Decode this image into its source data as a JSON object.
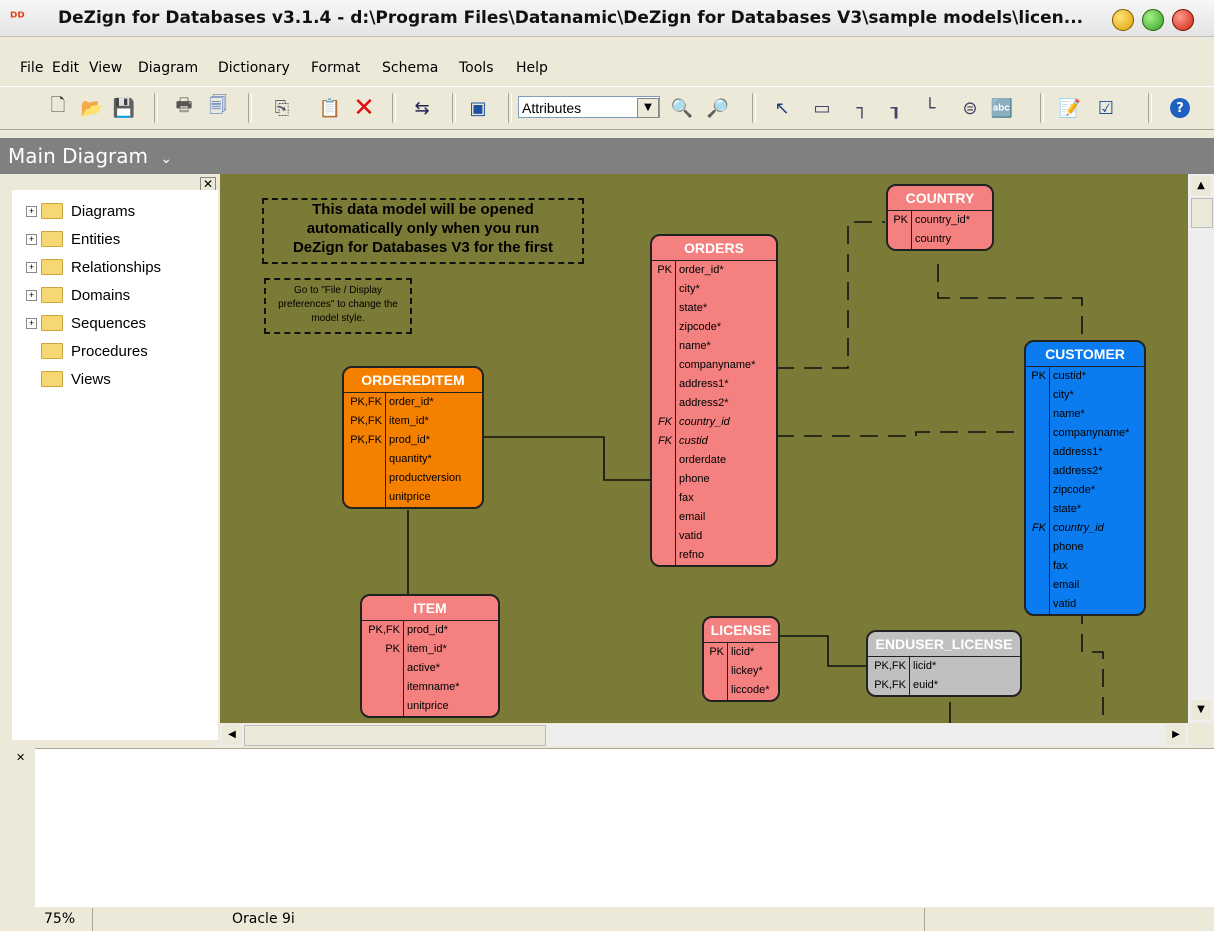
{
  "window": {
    "title": "DeZign for Databases v3.1.4 - d:\\Program Files\\Datanamic\\DeZign for Databases V3\\sample models\\licen..."
  },
  "menu": [
    "File",
    "Edit",
    "View",
    "Diagram",
    "Dictionary",
    "Format",
    "Schema",
    "Tools",
    "Help"
  ],
  "toolbar": {
    "display_mode": "Attributes"
  },
  "diagram_tab": {
    "label": "Main Diagram"
  },
  "tree": [
    "Diagrams",
    "Entities",
    "Relationships",
    "Domains",
    "Sequences",
    "Procedures",
    "Views"
  ],
  "notes": {
    "main": [
      "This data model will be opened",
      "automatically only when you run",
      "DeZign for Databases V3 for the first"
    ],
    "style": [
      "Go to \"File / Display",
      "preferences\" to change the",
      "model style."
    ]
  },
  "entities": {
    "country": {
      "name": "COUNTRY",
      "rows": [
        [
          "PK",
          "country_id*"
        ],
        [
          "",
          "country"
        ]
      ]
    },
    "orders": {
      "name": "ORDERS",
      "rows": [
        [
          "PK",
          "order_id*"
        ],
        [
          "",
          "city*"
        ],
        [
          "",
          "state*"
        ],
        [
          "",
          "zipcode*"
        ],
        [
          "",
          "name*"
        ],
        [
          "",
          "companyname*"
        ],
        [
          "",
          "address1*"
        ],
        [
          "",
          "address2*"
        ],
        [
          "FK",
          "country_id"
        ],
        [
          "FK",
          "custid"
        ],
        [
          "",
          "orderdate"
        ],
        [
          "",
          "phone"
        ],
        [
          "",
          "fax"
        ],
        [
          "",
          "email"
        ],
        [
          "",
          "vatid"
        ],
        [
          "",
          "refno"
        ]
      ]
    },
    "ordereditem": {
      "name": "ORDEREDITEM",
      "rows": [
        [
          "PK,FK",
          "order_id*"
        ],
        [
          "PK,FK",
          "item_id*"
        ],
        [
          "PK,FK",
          "prod_id*"
        ],
        [
          "",
          "quantity*"
        ],
        [
          "",
          "productversion"
        ],
        [
          "",
          "unitprice"
        ]
      ]
    },
    "customer": {
      "name": "CUSTOMER",
      "rows": [
        [
          "PK",
          "custid*"
        ],
        [
          "",
          "city*"
        ],
        [
          "",
          "name*"
        ],
        [
          "",
          "companyname*"
        ],
        [
          "",
          "address1*"
        ],
        [
          "",
          "address2*"
        ],
        [
          "",
          "zipcode*"
        ],
        [
          "",
          "state*"
        ],
        [
          "FK",
          "country_id"
        ],
        [
          "",
          "phone"
        ],
        [
          "",
          "fax"
        ],
        [
          "",
          "email"
        ],
        [
          "",
          "vatid"
        ]
      ]
    },
    "item": {
      "name": "ITEM",
      "rows": [
        [
          "PK,FK",
          "prod_id*"
        ],
        [
          "PK",
          "item_id*"
        ],
        [
          "",
          "active*"
        ],
        [
          "",
          "itemname*"
        ],
        [
          "",
          "unitprice"
        ]
      ]
    },
    "license": {
      "name": "LICENSE",
      "rows": [
        [
          "PK",
          "licid*"
        ],
        [
          "",
          "lickey*"
        ],
        [
          "",
          "liccode*"
        ]
      ]
    },
    "enduser_license": {
      "name": "ENDUSER_LICENSE",
      "rows": [
        [
          "PK,FK",
          "licid*"
        ],
        [
          "PK,FK",
          "euid*"
        ]
      ]
    }
  },
  "status": {
    "zoom": "75%",
    "database": "Oracle 9i"
  },
  "colors": {
    "canvas": "#7b7a36",
    "orders": "#f48080",
    "ordereditem": "#f58000",
    "customer": "#0a7cf0",
    "gray": "#c0c0c0"
  }
}
